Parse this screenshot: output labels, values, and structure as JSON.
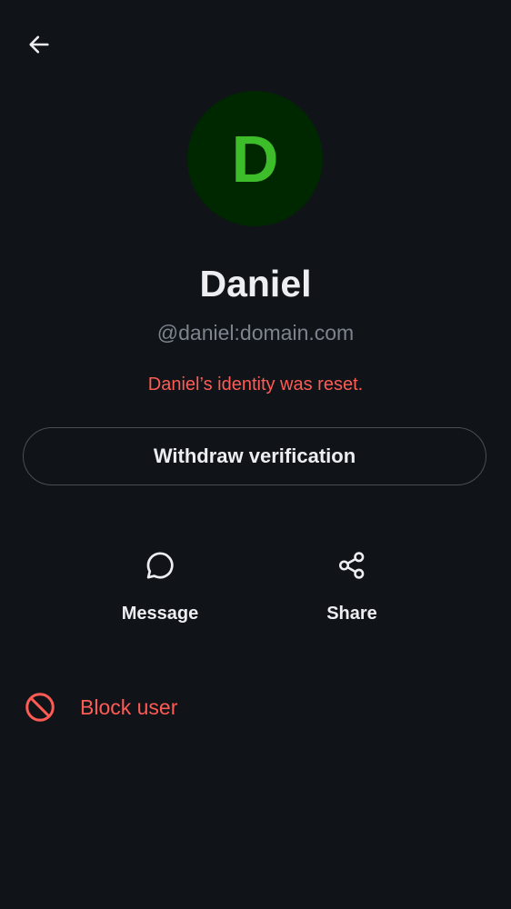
{
  "header": {
    "back_icon": "arrow-left-icon"
  },
  "profile": {
    "avatar_initial": "D",
    "avatar_bg_color": "#002800",
    "avatar_fg_color": "#3dbd2a",
    "display_name": "Daniel",
    "user_id": "@daniel:domain.com",
    "warning_text": "Daniel’s identity was reset.",
    "warning_color": "#ff5b55"
  },
  "actions": {
    "withdraw_label": "Withdraw verification",
    "items": [
      {
        "label": "Message",
        "icon": "chat-bubble-icon"
      },
      {
        "label": "Share",
        "icon": "share-icon"
      }
    ]
  },
  "danger": {
    "block_label": "Block user",
    "block_icon": "block-icon",
    "color": "#ff5b55"
  }
}
